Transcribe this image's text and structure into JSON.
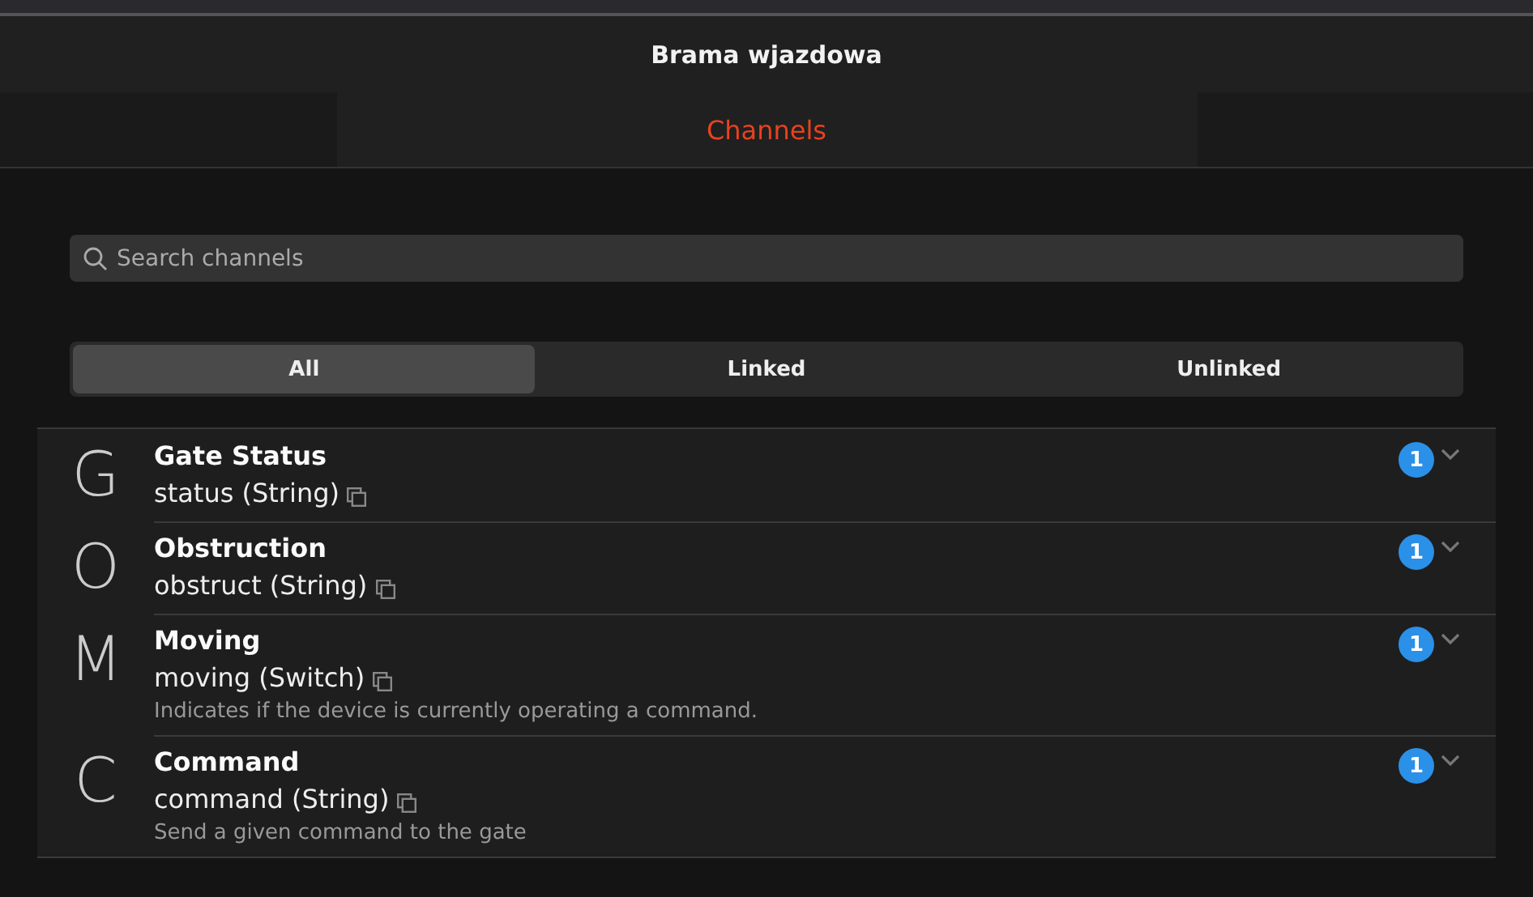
{
  "title": "Brama wjazdowa",
  "tabs": [
    {
      "label": "Channels",
      "selected": true
    }
  ],
  "search": {
    "placeholder": "Search channels"
  },
  "filters": [
    {
      "label": "All",
      "selected": true
    },
    {
      "label": "Linked",
      "selected": false
    },
    {
      "label": "Unlinked",
      "selected": false
    }
  ],
  "channels": [
    {
      "letter": "G",
      "name": "Gate Status",
      "id": "status (String)",
      "count": "1"
    },
    {
      "letter": "O",
      "name": "Obstruction",
      "id": "obstruct (String)",
      "count": "1"
    },
    {
      "letter": "M",
      "name": "Moving",
      "id": "moving (Switch)",
      "description": "Indicates if the device is currently operating a command.",
      "count": "1"
    },
    {
      "letter": "C",
      "name": "Command",
      "id": "command (String)",
      "description": "Send a given command to the gate",
      "count": "1"
    }
  ]
}
